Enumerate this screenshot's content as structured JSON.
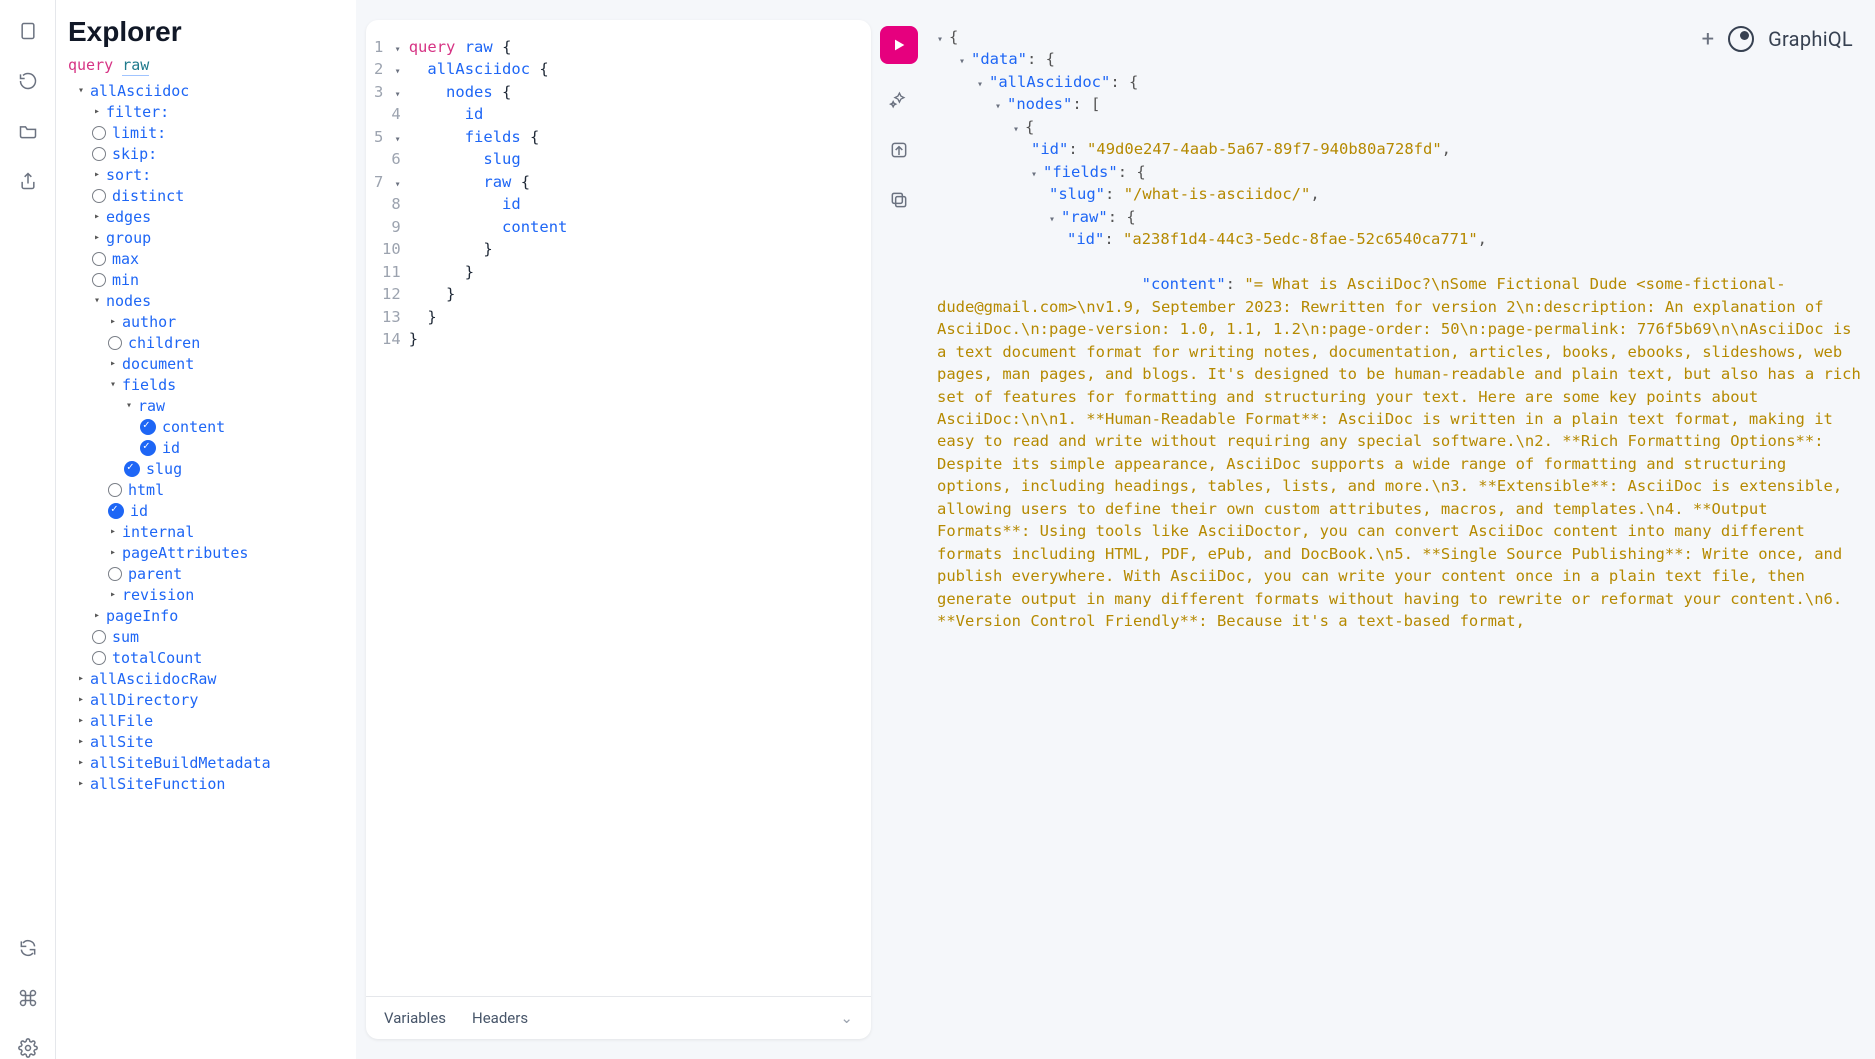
{
  "brand": {
    "name": "GraphiQL"
  },
  "explorer": {
    "title": "Explorer",
    "query_kw": "query",
    "query_name": "raw",
    "tree": [
      {
        "label": "allAsciidoc",
        "indent": 0,
        "arrow": "▾",
        "bold": true
      },
      {
        "label": "filter:",
        "indent": 1,
        "arrow": "▸"
      },
      {
        "label": "limit:",
        "indent": 1,
        "radio": true
      },
      {
        "label": "skip:",
        "indent": 1,
        "radio": true
      },
      {
        "label": "sort:",
        "indent": 1,
        "arrow": "▸"
      },
      {
        "label": "distinct",
        "indent": 1,
        "radio": true
      },
      {
        "label": "edges",
        "indent": 1,
        "arrow": "▸"
      },
      {
        "label": "group",
        "indent": 1,
        "arrow": "▸"
      },
      {
        "label": "max",
        "indent": 1,
        "radio": true
      },
      {
        "label": "min",
        "indent": 1,
        "radio": true
      },
      {
        "label": "nodes",
        "indent": 1,
        "arrow": "▾"
      },
      {
        "label": "author",
        "indent": 2,
        "arrow": "▸"
      },
      {
        "label": "children",
        "indent": 2,
        "radio": true
      },
      {
        "label": "document",
        "indent": 2,
        "arrow": "▸"
      },
      {
        "label": "fields",
        "indent": 2,
        "arrow": "▾"
      },
      {
        "label": "raw",
        "indent": 3,
        "arrow": "▾"
      },
      {
        "label": "content",
        "indent": 4,
        "check": true
      },
      {
        "label": "id",
        "indent": 4,
        "check": true
      },
      {
        "label": "slug",
        "indent": 3,
        "check": true
      },
      {
        "label": "html",
        "indent": 2,
        "radio": true
      },
      {
        "label": "id",
        "indent": 2,
        "check": true
      },
      {
        "label": "internal",
        "indent": 2,
        "arrow": "▸"
      },
      {
        "label": "pageAttributes",
        "indent": 2,
        "arrow": "▸"
      },
      {
        "label": "parent",
        "indent": 2,
        "radio": true
      },
      {
        "label": "revision",
        "indent": 2,
        "arrow": "▸"
      },
      {
        "label": "pageInfo",
        "indent": 1,
        "arrow": "▸"
      },
      {
        "label": "sum",
        "indent": 1,
        "radio": true
      },
      {
        "label": "totalCount",
        "indent": 1,
        "radio": true
      },
      {
        "label": "allAsciidocRaw",
        "indent": 0,
        "arrow": "▸"
      },
      {
        "label": "allDirectory",
        "indent": 0,
        "arrow": "▸"
      },
      {
        "label": "allFile",
        "indent": 0,
        "arrow": "▸"
      },
      {
        "label": "allSite",
        "indent": 0,
        "arrow": "▸"
      },
      {
        "label": "allSiteBuildMetadata",
        "indent": 0,
        "arrow": "▸"
      },
      {
        "label": "allSiteFunction",
        "indent": 0,
        "arrow": "▸"
      }
    ]
  },
  "editor": {
    "lines": [
      {
        "n": 1,
        "fold": "▾",
        "html": "<span class='tok-kw'>query</span> <span class='tok-field'>raw</span> <span class='tok-op'>{</span>"
      },
      {
        "n": 2,
        "fold": "▾",
        "html": "  <span class='tok-field'>allAsciidoc</span> <span class='tok-op'>{</span>"
      },
      {
        "n": 3,
        "fold": "▾",
        "html": "    <span class='tok-field'>nodes</span> <span class='tok-op'>{</span>"
      },
      {
        "n": 4,
        "fold": "",
        "html": "      <span class='tok-field'>id</span>"
      },
      {
        "n": 5,
        "fold": "▾",
        "html": "      <span class='tok-field'>fields</span> <span class='tok-op'>{</span>"
      },
      {
        "n": 6,
        "fold": "",
        "html": "        <span class='tok-field'>slug</span>"
      },
      {
        "n": 7,
        "fold": "▾",
        "html": "        <span class='tok-field'>raw</span> <span class='tok-op'>{</span>"
      },
      {
        "n": 8,
        "fold": "",
        "html": "          <span class='tok-field'>id</span>"
      },
      {
        "n": 9,
        "fold": "",
        "html": "          <span class='tok-field'>content</span>"
      },
      {
        "n": 10,
        "fold": "",
        "html": "        <span class='tok-op'>}</span>"
      },
      {
        "n": 11,
        "fold": "",
        "html": "      <span class='tok-op'>}</span>"
      },
      {
        "n": 12,
        "fold": "",
        "html": "    <span class='tok-op'>}</span>"
      },
      {
        "n": 13,
        "fold": "",
        "html": "  <span class='tok-op'>}</span>"
      },
      {
        "n": 14,
        "fold": "",
        "html": "<span class='tok-op'>}</span>"
      }
    ],
    "footer": {
      "variables": "Variables",
      "headers": "Headers"
    }
  },
  "results": {
    "data_key": "data",
    "allAsciidoc_key": "allAsciidoc",
    "nodes_key": "nodes",
    "id_key": "id",
    "id_val": "49d0e247-4aab-5a67-89f7-940b80a728fd",
    "fields_key": "fields",
    "slug_key": "slug",
    "slug_val": "/what-is-asciidoc/",
    "raw_key": "raw",
    "raw_id_key": "id",
    "raw_id_val": "a238f1d4-44c3-5edc-8fae-52c6540ca771",
    "content_key": "content",
    "content_val": "= What is AsciiDoc?\\nSome Fictional Dude <some-fictional-dude@gmail.com>\\nv1.9, September 2023: Rewritten for version 2\\n:description: An explanation of AsciiDoc.\\n:page-version: 1.0, 1.1, 1.2\\n:page-order: 50\\n:page-permalink: 776f5b69\\n\\nAsciiDoc is a text document format for writing notes, documentation, articles, books, ebooks, slideshows, web pages, man pages, and blogs. It's designed to be human-readable and plain text, but also has a rich set of features for formatting and structuring your text. Here are some key points about AsciiDoc:\\n\\n1. **Human-Readable Format**: AsciiDoc is written in a plain text format, making it easy to read and write without requiring any special software.\\n2. **Rich Formatting Options**: Despite its simple appearance, AsciiDoc supports a wide range of formatting and structuring options, including headings, tables, lists, and more.\\n3. **Extensible**: AsciiDoc is extensible, allowing users to define their own custom attributes, macros, and templates.\\n4. **Output Formats**: Using tools like AsciiDoctor, you can convert AsciiDoc content into many different formats including HTML, PDF, ePub, and DocBook.\\n5. **Single Source Publishing**: Write once, and publish everywhere. With AsciiDoc, you can write your content once in a plain text file, then generate output in many different formats without having to rewrite or reformat your content.\\n6. **Version Control Friendly**: Because it's a text-based format,"
  }
}
